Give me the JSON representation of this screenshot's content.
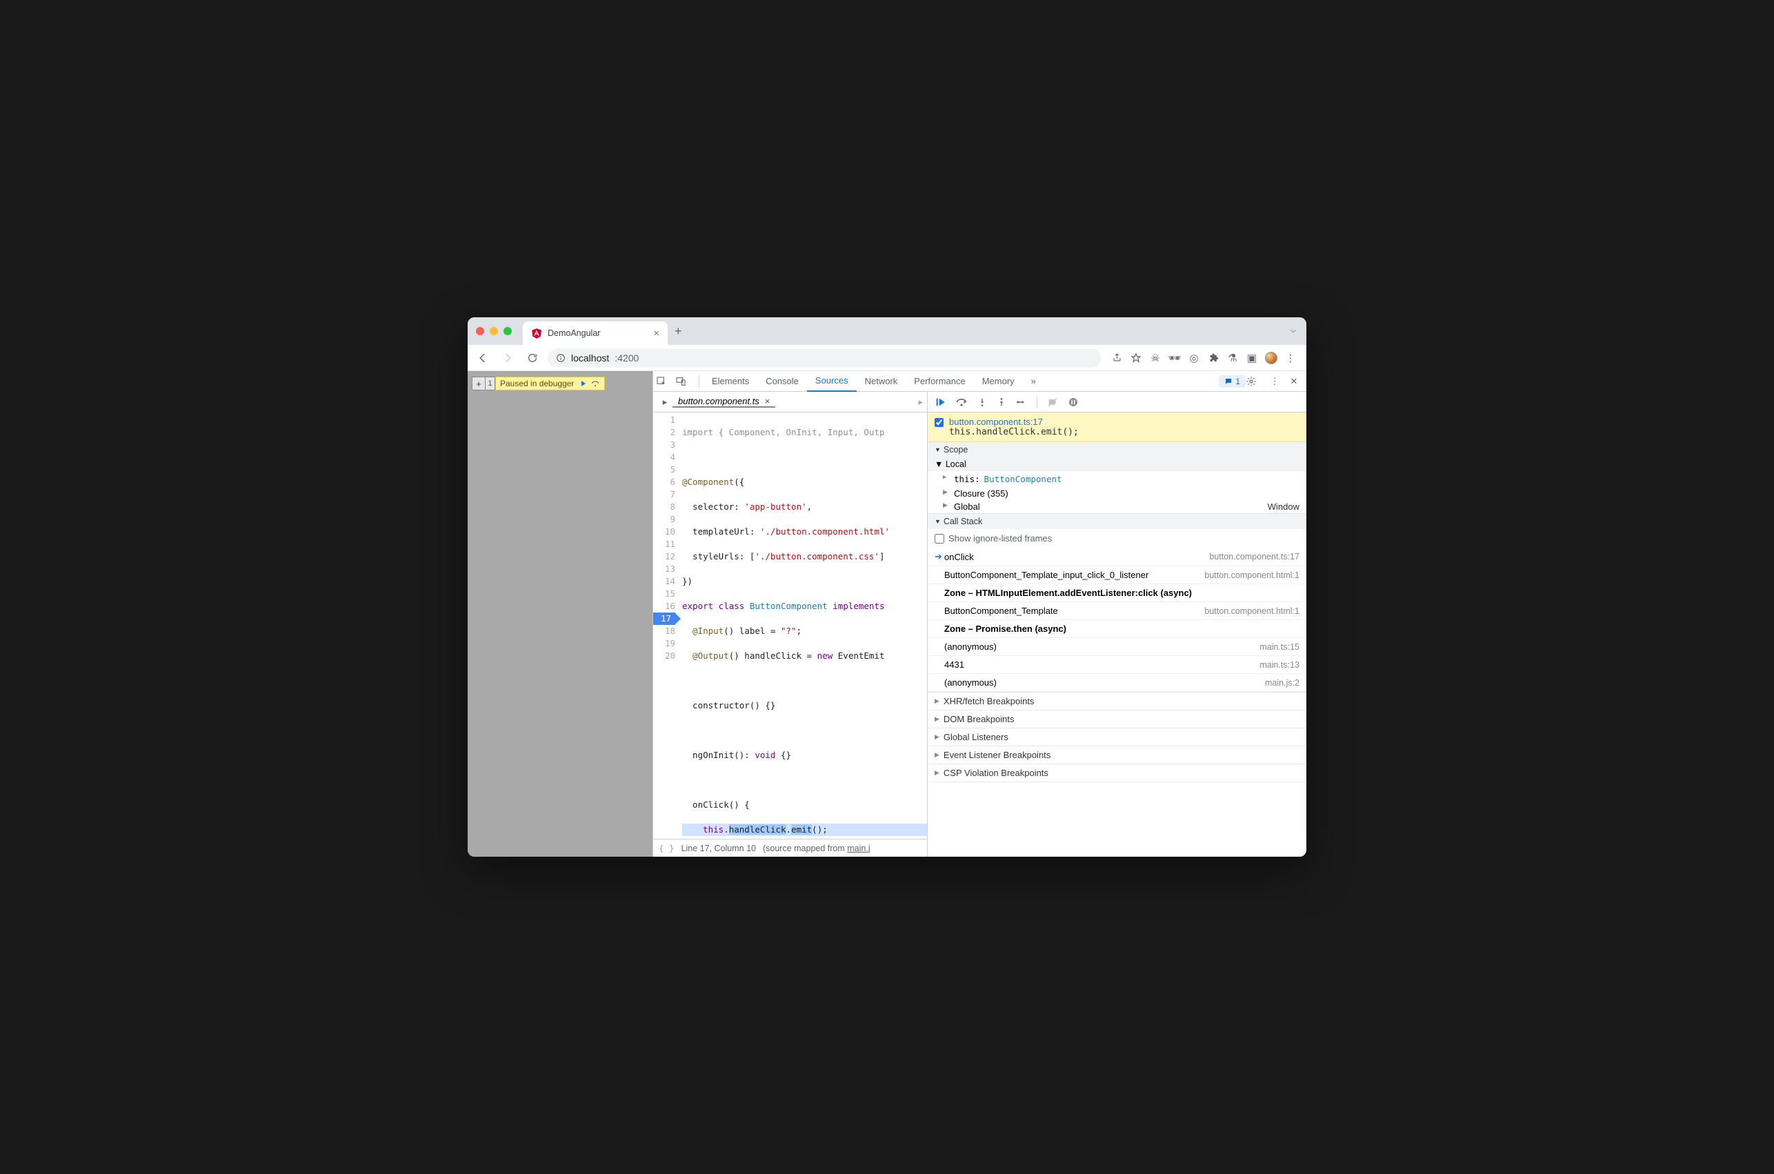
{
  "browser_tab": {
    "title": "DemoAngular"
  },
  "url": {
    "host": "localhost",
    "port": ":4200"
  },
  "paused": {
    "label": "Paused in debugger"
  },
  "page_badge": "1",
  "devtools": {
    "tabs": [
      "Elements",
      "Console",
      "Sources",
      "Network",
      "Performance",
      "Memory"
    ],
    "active_tab": "Sources",
    "more": "»",
    "issues_count": "1"
  },
  "file": {
    "name": "button.component.ts"
  },
  "code": {
    "gutter": [
      "1",
      "2",
      "3",
      "4",
      "5",
      "6",
      "7",
      "8",
      "9",
      "10",
      "11",
      "12",
      "13",
      "14",
      "15",
      "16",
      "17",
      "18",
      "19",
      "20"
    ],
    "lines": {
      "l1": "import { Component, OnInit, Input, Outp",
      "l3a": "@Component",
      "l3b": "({",
      "l4a": "  selector: ",
      "l4b": "'app-button'",
      "l4c": ",",
      "l5a": "  templateUrl: ",
      "l5b": "'./button.component.html'",
      "l6a": "  styleUrls: [",
      "l6b": "'./button.component.css'",
      "l6c": "]",
      "l7": "})",
      "l8a": "export class ",
      "l8b": "ButtonComponent ",
      "l8c": "implements",
      "l9a": "  @Input",
      "l9b": "() label = ",
      "l9c": "\"?\"",
      "l9d": ";",
      "l10a": "  @Output",
      "l10b": "() handleClick = ",
      "l10c": "new",
      "l10d": " EventEmit",
      "l12": "  constructor() {}",
      "l14a": "  ngOnInit(): ",
      "l14b": "void",
      "l14c": " {}",
      "l16": "  onClick() {",
      "l17a": "    this.",
      "l17b": "handleClick",
      "l17c": ".",
      "l17d": "emit",
      "l17e": "();",
      "l18": "  }",
      "l19": "}"
    }
  },
  "status": {
    "line": "Line 17, Column 10",
    "mapped": "(source mapped from ",
    "mapped_link": "main.j"
  },
  "breakpoint": {
    "file": "button.component.ts:17",
    "code": "this.handleClick.emit();"
  },
  "scope": {
    "header": "Scope",
    "local": "Local",
    "this_label": "this:",
    "this_val": "ButtonComponent",
    "closure": "Closure (355)",
    "global": "Global",
    "global_val": "Window"
  },
  "callstack": {
    "header": "Call Stack",
    "show_ignored": "Show ignore-listed frames",
    "frames": [
      {
        "name": "onClick",
        "loc": "button.component.ts:17",
        "current": true
      },
      {
        "name": "ButtonComponent_Template_input_click_0_listener",
        "loc": "button.component.html:1"
      },
      {
        "name": "Zone – HTMLInputElement.addEventListener:click (async)",
        "async": true
      },
      {
        "name": "ButtonComponent_Template",
        "loc": "button.component.html:1"
      },
      {
        "name": "Zone – Promise.then (async)",
        "async": true
      },
      {
        "name": "(anonymous)",
        "loc": "main.ts:15"
      },
      {
        "name": "4431",
        "loc": "main.ts:13"
      },
      {
        "name": "(anonymous)",
        "loc": "main.js:2"
      }
    ]
  },
  "sections": {
    "xhr": "XHR/fetch Breakpoints",
    "dom": "DOM Breakpoints",
    "gl": "Global Listeners",
    "el": "Event Listener Breakpoints",
    "csp": "CSP Violation Breakpoints"
  }
}
